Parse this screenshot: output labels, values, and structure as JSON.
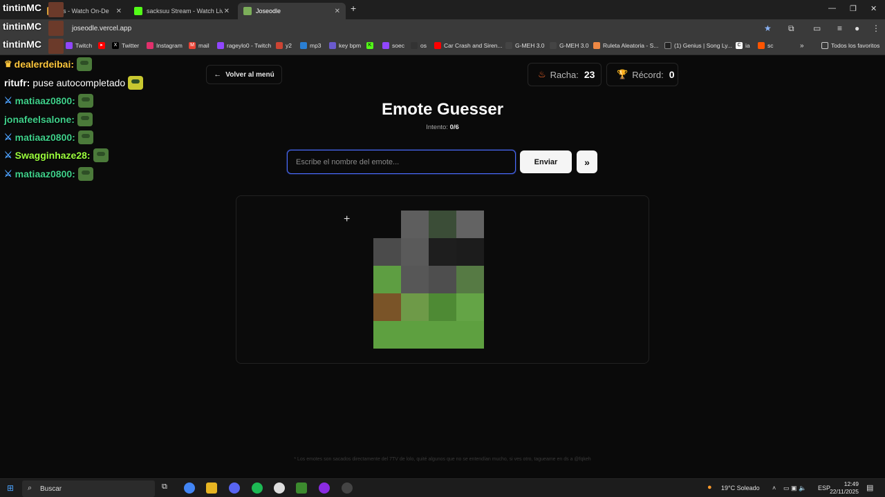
{
  "browser": {
    "tabs": [
      {
        "label": "os - Watch On-De",
        "active": false
      },
      {
        "label": "sacksuu Stream - Watch Live on",
        "active": false
      },
      {
        "label": "Joseodle",
        "active": true
      }
    ],
    "url": "joseodle.vercel.app",
    "bookmarks": [
      "Twitch",
      "Twitter",
      "Instagram",
      "mail",
      "rageylo0 - Twitch",
      "y2",
      "mp3",
      "key bpm",
      "soec",
      "os",
      "Car Crash and Siren...",
      "G-MEH 3.0",
      "G-MEH 3.0",
      "Ruleta Aleatoria - S...",
      "(1) Genius | Song Ly...",
      "ia",
      "sc"
    ],
    "all_bookmarks_label": "Todos los favoritos"
  },
  "overlay": {
    "streamer": "tintinMC",
    "chat": [
      {
        "user": "dealerdeibai",
        "message": "",
        "color": "#ffc83d",
        "badge": "crown"
      },
      {
        "user": "ritufr",
        "message": "puse autocompletado",
        "color": "#ffffff",
        "badge": ""
      },
      {
        "user": "matiaaz0800",
        "message": "",
        "color": "#3fd08a",
        "badge": "sword"
      },
      {
        "user": "jonafeelsalone",
        "message": "",
        "color": "#3fd08a",
        "badge": ""
      },
      {
        "user": "matiaaz0800",
        "message": "",
        "color": "#3fd08a",
        "badge": "sword"
      },
      {
        "user": "Swagginhaze28",
        "message": "",
        "color": "#9cff3d",
        "badge": "sword"
      },
      {
        "user": "matiaaz0800",
        "message": "",
        "color": "#3fd08a",
        "badge": "sword"
      }
    ]
  },
  "page": {
    "back_label": "Volver al menú",
    "streak_label": "Racha:",
    "streak_value": "23",
    "record_label": "Récord:",
    "record_value": "0",
    "title": "Emote Guesser",
    "attempt_label": "Intento:",
    "attempt_value": "0/6",
    "input_placeholder": "Escribe el nombre del emote...",
    "send_label": "Enviar",
    "skip_label": "»",
    "pixels": [
      [
        "#0b0b0b",
        "#5e5e5e",
        "#3b4d37",
        "#636363"
      ],
      [
        "#4b4b4b",
        "#5a5a5a",
        "#1e1e1e",
        "#1c1c1c"
      ],
      [
        "#5e9e42",
        "#575757",
        "#4e4e4e",
        "#567a44"
      ],
      [
        "#7a5428",
        "#6e9a48",
        "#4e8a34",
        "#64a446"
      ],
      [
        "#5ea040",
        "#5ea040",
        "#5ea040",
        "#5ea040"
      ]
    ],
    "footer": "* Los emotes son sacados directamente del 7TV de lolo, quité algunos que no se entendían mucho, si ves otro, tagueame en ds a @fqkeh"
  },
  "taskbar": {
    "search_label": "Buscar",
    "weather": "19°C  Soleado",
    "lang": "ESP",
    "time": "12:49",
    "date": "22/11/2025"
  }
}
